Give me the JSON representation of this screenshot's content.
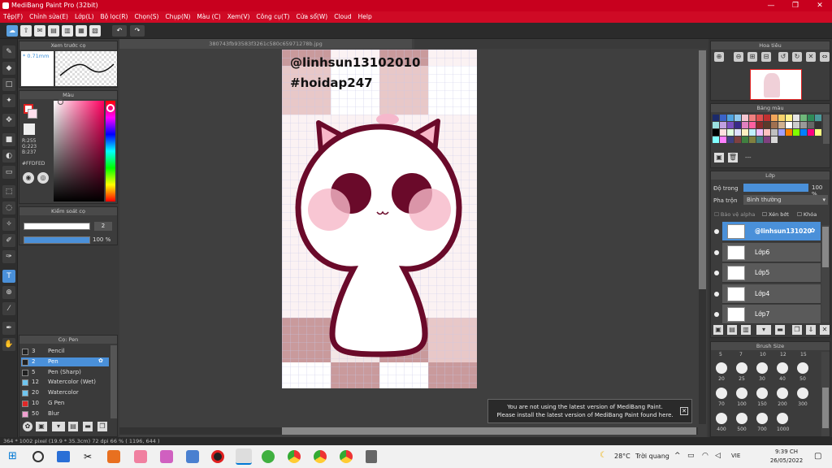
{
  "app": {
    "title": "MediBang Paint Pro (32bit)"
  },
  "window_buttons": [
    "—",
    "❐",
    "✕"
  ],
  "menu": [
    "Tệp(F)",
    "Chỉnh sửa(E)",
    "Lớp(L)",
    "Bộ lọc(R)",
    "Chọn(S)",
    "Chụp(N)",
    "Màu (C)",
    "Xem(V)",
    "Công cụ(T)",
    "Cửa sổ(W)",
    "Cloud",
    "Help"
  ],
  "document": {
    "tab_name": "380743fb93583f3261c580c65971278b.jpg"
  },
  "artwork": {
    "watermark_line1": "@linhsun13102010",
    "watermark_line2": "#hoidap247"
  },
  "preview_panel": {
    "title": "Xem trước cọ",
    "size": "0.71mm"
  },
  "color_panel": {
    "title": "Màu",
    "r": "R:255",
    "g": "G:223",
    "b": "B:237",
    "hex": "#FFDFED",
    "color": "#FFDFED"
  },
  "brush_control": {
    "title": "Kiểm soát cọ",
    "size": "2",
    "opacity": "100 %"
  },
  "brush_list": {
    "title": "Cọ: Pen",
    "items": [
      {
        "size": "3",
        "name": "Pencil",
        "color": "#222222"
      },
      {
        "size": "2",
        "name": "Pen",
        "color": "#222222"
      },
      {
        "size": "5",
        "name": "Pen (Sharp)",
        "color": "#222222"
      },
      {
        "size": "12",
        "name": "Watercolor (Wet)",
        "color": "#6fc6f0"
      },
      {
        "size": "20",
        "name": "Watercolor",
        "color": "#6fc6f0"
      },
      {
        "size": "10",
        "name": "G Pen",
        "color": "#e02828"
      },
      {
        "size": "50",
        "name": "Blur",
        "color": "#f0a0d0"
      }
    ]
  },
  "navigator": {
    "title": "Hoa tiêu"
  },
  "palette": {
    "title": "Bảng màu",
    "add_label": "---",
    "colors": [
      "#1b2a6b",
      "#3a63c8",
      "#4fa3e0",
      "#8fc9ef",
      "#f5c6d0",
      "#f08080",
      "#e05050",
      "#c03030",
      "#f2a65a",
      "#f7d26b",
      "#fff08a",
      "#e6e6e6",
      "#6fb87a",
      "#2e8b57",
      "#4a9a9a",
      "#9be0e0",
      "#c0a0e0",
      "#7a4fc0",
      "#3a2a8a",
      "#e080c0",
      "#ff5fa0",
      "#8b2a2a",
      "#5a3a2a",
      "#a07050",
      "#d0b090",
      "#ffffff",
      "#cccccc",
      "#999999",
      "#666666",
      "#333333",
      "#000000",
      "#ffe0e0",
      "#e0ffe0",
      "#e0e0ff",
      "#fff0c0",
      "#c0f0ff",
      "#f0c0ff",
      "#ffc0c0",
      "#c0c0c0",
      "#a0a0ff",
      "#ff8000",
      "#80ff00",
      "#0080ff",
      "#ff0080",
      "#ffff80",
      "#80ffff",
      "#ff80ff",
      "#404080",
      "#804040",
      "#408040",
      "#808040",
      "#408080",
      "#804080",
      "#d8d8d8"
    ]
  },
  "layers_panel": {
    "title": "Lớp",
    "opacity_label": "Độ trong",
    "opacity_value": "100 %",
    "blend_label": "Pha trộn",
    "blend_value": "Bình thường",
    "protect_alpha": "Bảo vệ alpha",
    "clipping": "Xén bớt",
    "lock": "Khóa",
    "layers": [
      "@linhsun131020",
      "Lớp6",
      "Lớp5",
      "Lớp4",
      "Lớp7"
    ]
  },
  "brush_size": {
    "title": "Brush Size",
    "top_row": [
      "5",
      "7",
      "10",
      "12",
      "15"
    ],
    "sizes": [
      "20",
      "25",
      "30",
      "40",
      "50",
      "70",
      "100",
      "150",
      "200",
      "300",
      "400",
      "500",
      "700",
      "1000"
    ]
  },
  "notification": {
    "line1": "You are not using the latest version of MediBang Paint.",
    "line2": "Please install the latest version of MediBang Paint found here."
  },
  "status": {
    "text": "364 * 1002 pixel   (19.9 * 35.3cm)   72 dpi   66 %   ( 1196, 644 )"
  },
  "taskbar": {
    "weather_temp": "28°C",
    "weather_text": "Trời quang",
    "lang": "VIE",
    "time": "9:39 CH",
    "date": "26/05/2022"
  }
}
